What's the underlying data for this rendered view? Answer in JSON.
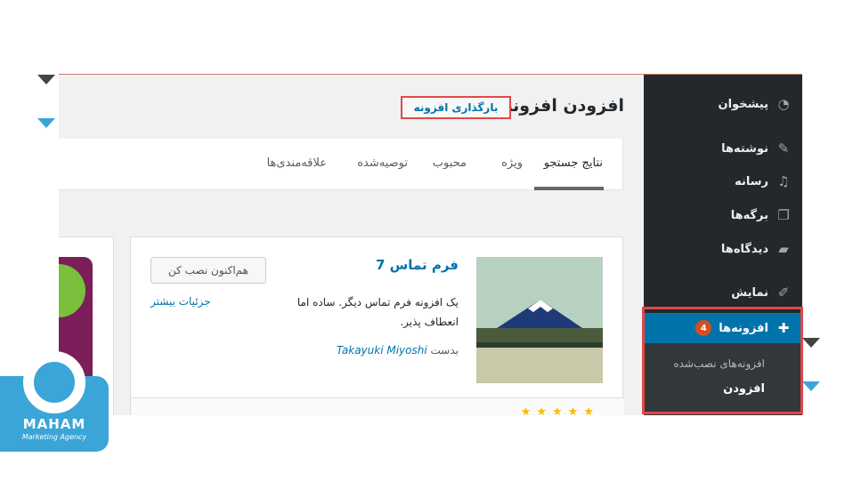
{
  "page": {
    "title": "افزودن افزونه",
    "upload_button": "بارگذاری افزونه"
  },
  "menu": {
    "items": [
      {
        "label": "پیشخوان",
        "icon": "dashboard-icon"
      },
      {
        "label": "نوشته‌ها",
        "icon": "pin-icon"
      },
      {
        "label": "رسانه",
        "icon": "media-icon"
      },
      {
        "label": "برگه‌ها",
        "icon": "pages-icon"
      },
      {
        "label": "دیدگاه‌ها",
        "icon": "comments-icon"
      },
      {
        "label": "نمایش",
        "icon": "appearance-icon"
      }
    ],
    "plugins": {
      "label": "افزونه‌ها",
      "badge": "4",
      "icon": "plugins-icon"
    },
    "submenu": [
      {
        "label": "افزونه‌های نصب‌شده"
      },
      {
        "label": "افزودن"
      }
    ]
  },
  "tabs": [
    {
      "label": "نتایج جستجو"
    },
    {
      "label": "ویژه"
    },
    {
      "label": "محبوب"
    },
    {
      "label": "توصیه‌شده"
    },
    {
      "label": "علاقه‌مندی‌ها"
    }
  ],
  "plugin_card": {
    "title": "فرم تماس 7",
    "description": "یک افزونه فرم تماس دیگر. ساده اما انعطاف پذیر.",
    "author_prefix": "بدست",
    "author": "Takayuki Miyoshi",
    "install_button": "هم‌اکنون نصب کن",
    "details_link": "جزئیات بیشتر",
    "stars": "★★★★★"
  },
  "logo": {
    "name": "MAHAM",
    "tagline": "Marketing Agency"
  },
  "colors": {
    "sidebar": "#23282d",
    "accent": "#0073aa",
    "highlight": "#e04848",
    "brand": "#3ba5d8"
  }
}
